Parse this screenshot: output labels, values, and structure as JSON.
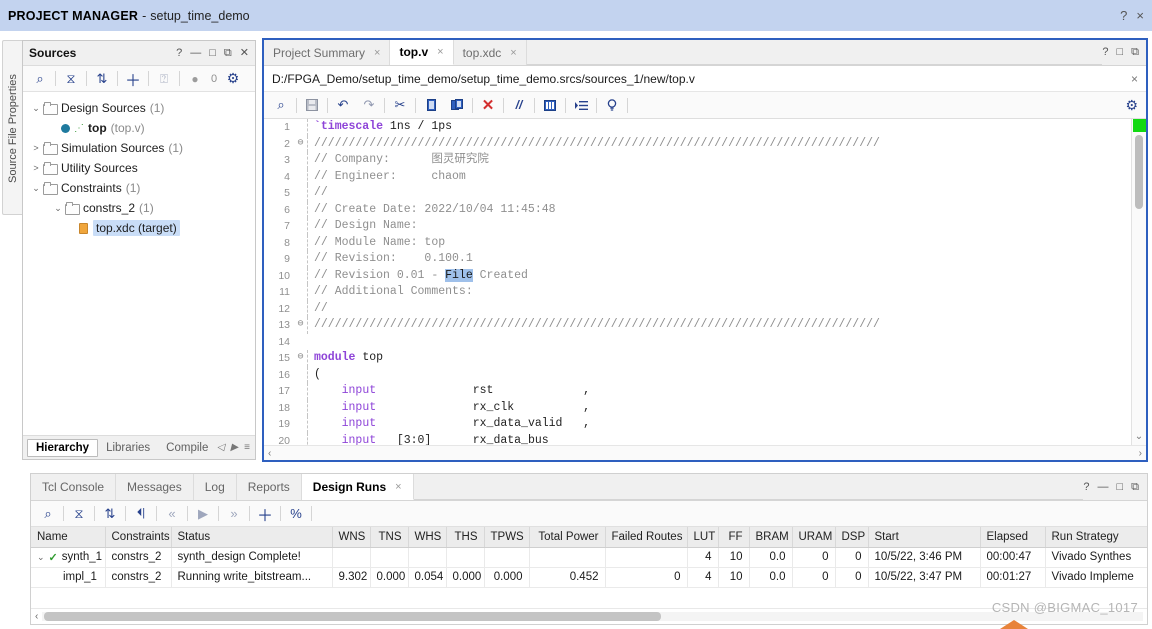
{
  "titlebar": {
    "mode": "PROJECT MANAGER",
    "dash": "-",
    "project": "setup_time_demo",
    "help": "?",
    "close": "×"
  },
  "left_vtab": {
    "label": "Source File Properties"
  },
  "sources": {
    "title": "Sources",
    "header_buttons": [
      "?",
      "—",
      "□",
      "⧉",
      "✕"
    ],
    "toolbar": [
      {
        "name": "search-icon",
        "glyph": "⌕"
      },
      {
        "name": "collapse-all-icon",
        "glyph": "⧖"
      },
      {
        "name": "expand-all-icon",
        "glyph": "⇅"
      },
      {
        "name": "add-sources-icon",
        "glyph": "＋"
      },
      {
        "name": "report-icon",
        "glyph": "⍰"
      },
      {
        "name": "status-dot-icon",
        "glyph": "●"
      },
      {
        "name": "status-count",
        "glyph": "0"
      },
      {
        "name": "settings-gear-icon",
        "glyph": "⚙"
      }
    ],
    "tree": [
      {
        "indent": 0,
        "twist": "⌄",
        "icon": "folder",
        "label": "Design Sources",
        "count": "(1)",
        "selected": false
      },
      {
        "indent": 1,
        "twist": "",
        "icon": "verilog",
        "label": "top",
        "count": "(top.v)",
        "selected": false,
        "bold": true
      },
      {
        "indent": 0,
        "twist": ">",
        "icon": "folder",
        "label": "Simulation Sources",
        "count": "(1)",
        "selected": false
      },
      {
        "indent": 0,
        "twist": ">",
        "icon": "folder",
        "label": "Utility Sources",
        "count": "",
        "selected": false
      },
      {
        "indent": 0,
        "twist": "⌄",
        "icon": "folder",
        "label": "Constraints",
        "count": "(1)",
        "selected": false
      },
      {
        "indent": 1,
        "twist": "⌄",
        "icon": "folder",
        "label": "constrs_2",
        "count": "(1)",
        "selected": false
      },
      {
        "indent": 2,
        "twist": "",
        "icon": "xdc",
        "label": "top.xdc (target)",
        "count": "",
        "selected": true
      }
    ],
    "bottom_tabs": [
      {
        "label": "Hierarchy",
        "active": true
      },
      {
        "label": "Libraries",
        "active": false
      },
      {
        "label": "Compile ",
        "active": false
      }
    ],
    "bottom_nav": [
      "◁",
      "▶",
      "≡"
    ]
  },
  "editor": {
    "tabs": [
      {
        "label": "Project Summary",
        "active": false,
        "close": "×"
      },
      {
        "label": "top.v",
        "active": true,
        "close": "×"
      },
      {
        "label": "top.xdc",
        "active": false,
        "close": "×"
      }
    ],
    "header_buttons": [
      "?",
      "□",
      "⧉"
    ],
    "file_path": "D:/FPGA_Demo/setup_time_demo/setup_time_demo.srcs/sources_1/new/top.v",
    "path_close": "×",
    "toolbar": [
      {
        "name": "find-icon",
        "glyph": "⌕"
      },
      {
        "name": "save-icon",
        "glyph": "Ὃe"
      },
      {
        "name": "undo-icon",
        "glyph": "↶"
      },
      {
        "name": "redo-icon",
        "glyph": "↷"
      },
      {
        "name": "cut-icon",
        "glyph": "✂"
      },
      {
        "name": "copy-icon",
        "glyph": "❐"
      },
      {
        "name": "paste-icon",
        "glyph": "❑"
      },
      {
        "name": "delete-icon",
        "glyph": "✕"
      },
      {
        "name": "comment-icon",
        "glyph": "//"
      },
      {
        "name": "insert-template-icon",
        "glyph": "☷"
      },
      {
        "name": "indent-icon",
        "glyph": "⤑"
      },
      {
        "name": "tip-icon",
        "glyph": "○"
      }
    ],
    "settings_icon": "⚙",
    "code": [
      {
        "n": "1",
        "fold": "",
        "segs": [
          {
            "t": "`timescale",
            "c": "kw"
          },
          {
            "t": " 1ns / 1ps",
            "c": ""
          }
        ]
      },
      {
        "n": "2",
        "fold": "⊖",
        "segs": [
          {
            "t": "//////////////////////////////////////////////////////////////////////////////////",
            "c": "cmt"
          }
        ]
      },
      {
        "n": "3",
        "fold": "",
        "segs": [
          {
            "t": "// Company:      图灵研究院",
            "c": "cmt"
          }
        ]
      },
      {
        "n": "4",
        "fold": "",
        "segs": [
          {
            "t": "// Engineer:     chaom",
            "c": "cmt"
          }
        ]
      },
      {
        "n": "5",
        "fold": "",
        "segs": [
          {
            "t": "// ",
            "c": "cmt"
          }
        ]
      },
      {
        "n": "6",
        "fold": "",
        "segs": [
          {
            "t": "// Create Date: 2022/10/04 11:45:48",
            "c": "cmt"
          }
        ]
      },
      {
        "n": "7",
        "fold": "",
        "segs": [
          {
            "t": "// Design Name: ",
            "c": "cmt"
          }
        ]
      },
      {
        "n": "8",
        "fold": "",
        "segs": [
          {
            "t": "// Module Name: top",
            "c": "cmt"
          }
        ]
      },
      {
        "n": "9",
        "fold": "",
        "segs": [
          {
            "t": "// Revision:    0.100.1",
            "c": "cmt"
          }
        ]
      },
      {
        "n": "10",
        "fold": "",
        "segs": [
          {
            "t": "// Revision 0.01 - ",
            "c": "cmt"
          },
          {
            "t": "File",
            "c": "hl"
          },
          {
            "t": " Created",
            "c": "cmt"
          }
        ]
      },
      {
        "n": "11",
        "fold": "",
        "segs": [
          {
            "t": "// Additional Comments:",
            "c": "cmt"
          }
        ]
      },
      {
        "n": "12",
        "fold": "",
        "segs": [
          {
            "t": "// ",
            "c": "cmt"
          }
        ]
      },
      {
        "n": "13",
        "fold": "⊖",
        "segs": [
          {
            "t": "//////////////////////////////////////////////////////////////////////////////////",
            "c": "cmt"
          }
        ]
      },
      {
        "n": "14",
        "fold": "",
        "segs": [
          {
            "t": "",
            "c": ""
          }
        ]
      },
      {
        "n": "15",
        "fold": "⊖",
        "segs": [
          {
            "t": "module",
            "c": "kw"
          },
          {
            "t": " top",
            "c": ""
          }
        ]
      },
      {
        "n": "16",
        "fold": "",
        "segs": [
          {
            "t": "(",
            "c": ""
          }
        ]
      },
      {
        "n": "17",
        "fold": "",
        "segs": [
          {
            "t": "    ",
            "c": ""
          },
          {
            "t": "input",
            "c": "kw2"
          },
          {
            "t": "              rst             ,",
            "c": ""
          }
        ]
      },
      {
        "n": "18",
        "fold": "",
        "segs": [
          {
            "t": "    ",
            "c": ""
          },
          {
            "t": "input",
            "c": "kw2"
          },
          {
            "t": "              rx_clk          ,",
            "c": ""
          }
        ]
      },
      {
        "n": "19",
        "fold": "",
        "segs": [
          {
            "t": "    ",
            "c": ""
          },
          {
            "t": "input",
            "c": "kw2"
          },
          {
            "t": "              rx_data_valid   ,",
            "c": ""
          }
        ]
      },
      {
        "n": "20",
        "fold": "",
        "segs": [
          {
            "t": "    ",
            "c": ""
          },
          {
            "t": "input",
            "c": "kw2"
          },
          {
            "t": "   [3:0]      rx_data_bus",
            "c": ""
          }
        ]
      }
    ],
    "scroll": {
      "up": "⌃",
      "down": "⌄",
      "left": "‹",
      "right": "›"
    }
  },
  "bottom_panel": {
    "tabs": [
      {
        "label": "Tcl Console",
        "active": false,
        "close": ""
      },
      {
        "label": "Messages",
        "active": false,
        "close": ""
      },
      {
        "label": "Log",
        "active": false,
        "close": ""
      },
      {
        "label": "Reports",
        "active": false,
        "close": ""
      },
      {
        "label": "Design Runs",
        "active": true,
        "close": "×"
      }
    ],
    "header_buttons": [
      "?",
      "—",
      "□",
      "⧉"
    ],
    "toolbar": [
      {
        "name": "search-icon",
        "glyph": "⌕",
        "dim": false
      },
      {
        "name": "collapse-all-icon",
        "glyph": "⧖",
        "dim": false
      },
      {
        "name": "expand-all-icon",
        "glyph": "⇅",
        "dim": false
      },
      {
        "name": "first-run-icon",
        "glyph": "⏴|",
        "dim": false
      },
      {
        "name": "previous-run-icon",
        "glyph": "«",
        "dim": true
      },
      {
        "name": "run-icon",
        "glyph": "▶",
        "dim": true
      },
      {
        "name": "next-run-icon",
        "glyph": "»",
        "dim": true
      },
      {
        "name": "add-run-icon",
        "glyph": "＋",
        "dim": false
      },
      {
        "name": "percent-icon",
        "glyph": "%",
        "dim": false
      }
    ],
    "table": {
      "columns": [
        "Name",
        "Constraints",
        "Status",
        "WNS",
        "TNS",
        "WHS",
        "THS",
        "TPWS",
        "Total Power",
        "Failed Routes",
        "LUT",
        "FF",
        "BRAM",
        "URAM",
        "DSP",
        "Start",
        "Elapsed",
        "Run Strategy"
      ],
      "rows": [
        {
          "twist": "⌄",
          "check": "✓",
          "name": "synth_1",
          "indent": false,
          "cells": [
            "constrs_2",
            "synth_design Complete!",
            "",
            "",
            "",
            "",
            "",
            "",
            "",
            "4",
            "10",
            "0.0",
            "0",
            "0",
            "10/5/22, 3:46 PM",
            "00:00:47",
            "Vivado Synthes"
          ]
        },
        {
          "twist": "",
          "check": "",
          "name": "impl_1",
          "indent": true,
          "cells": [
            "constrs_2",
            "Running write_bitstream...",
            "9.302",
            "0.000",
            "0.054",
            "0.000",
            "0.000",
            "0.452",
            "0",
            "4",
            "10",
            "0.0",
            "0",
            "0",
            "10/5/22, 3:47 PM",
            "00:01:27",
            "Vivado Impleme"
          ]
        }
      ]
    },
    "hscroll": {
      "left": "‹",
      "right": "›"
    }
  },
  "watermark": {
    "text": "CSDN @BIGMAC_1017",
    "arrow": "›"
  },
  "colors": {
    "titlebar_bg": "#c3d3ef",
    "editor_border": "#2e5fbf",
    "selection_blue": "#c9ddf7",
    "highlight_blue": "#9fc0ea",
    "toolbar_icon": "#27418c",
    "check_green": "#2f9b2f",
    "marker_green": "#12d912",
    "keyword_purple": "#8e44d8",
    "comment_gray": "#8f8f8f",
    "delete_red": "#d32f2f"
  }
}
